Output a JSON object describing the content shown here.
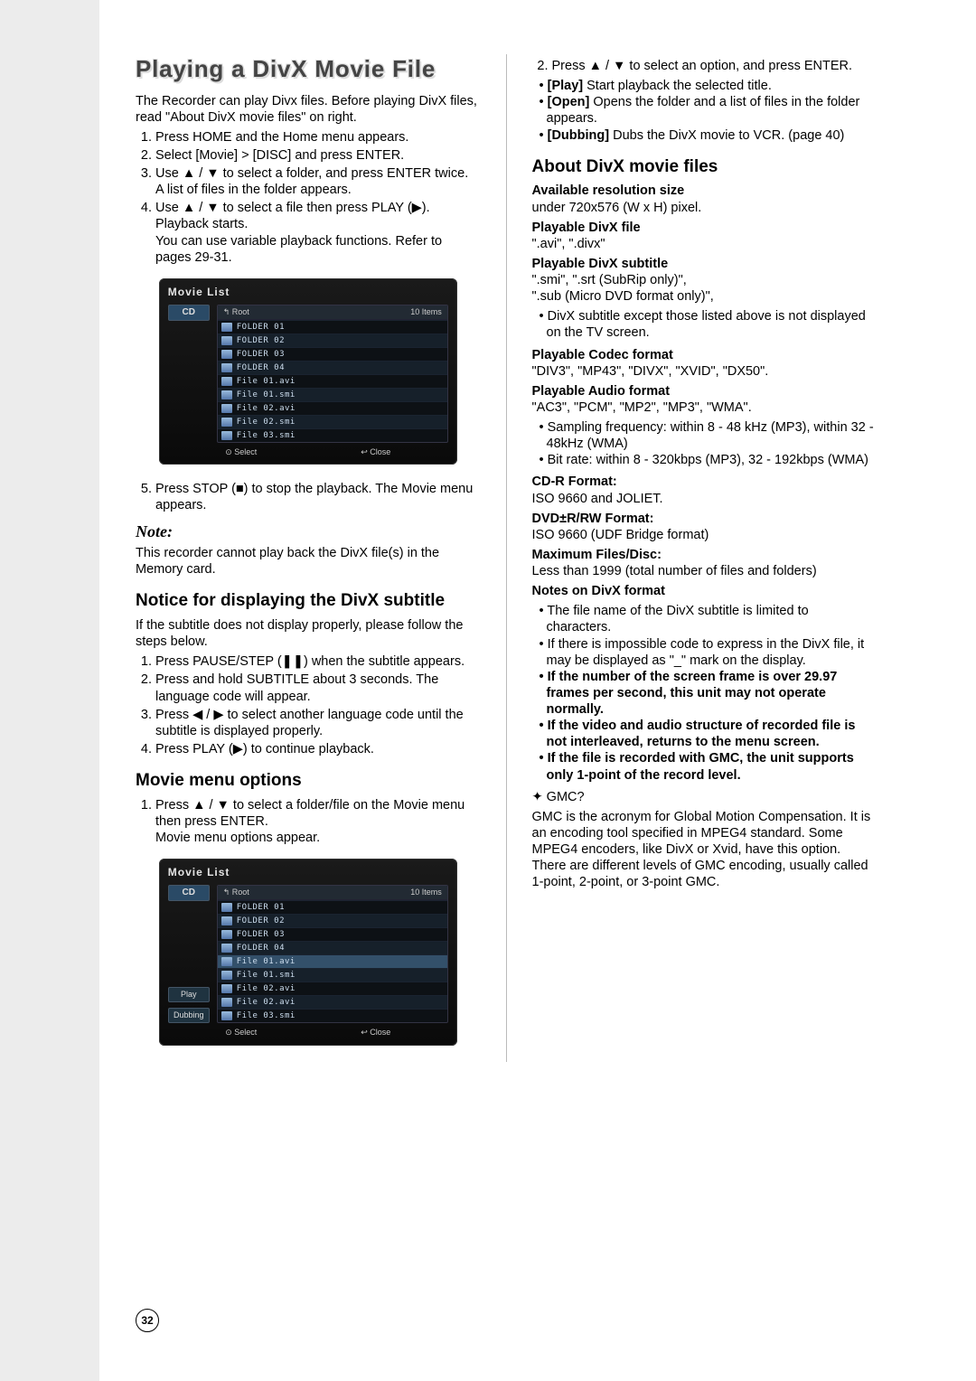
{
  "page_number": "32",
  "title": "Playing a DivX Movie File",
  "intro": "The Recorder can play Divx files. Before playing DivX files, read \"About DivX movie files\" on right.",
  "steps_main": [
    "Press HOME and the Home menu appears.",
    "Select [Movie] > [DISC] and press ENTER.",
    "Use ▲ / ▼ to select a folder, and press ENTER twice.\nA list of files in the folder appears.",
    "Use ▲ / ▼ to select a file then press PLAY (▶). Playback starts.\nYou can use variable playback functions. Refer to pages 29-31."
  ],
  "movie_list_panel_1": {
    "title": "Movie List",
    "disc": "CD",
    "head_left": "↰ Root",
    "head_right": "10 Items",
    "rows": [
      "FOLDER 01",
      "FOLDER 02",
      "FOLDER 03",
      "FOLDER 04",
      "File 01.avi",
      "File 01.smi",
      "File 02.avi",
      "File 02.smi",
      "File 03.smi"
    ],
    "foot_select": "⊙ Select",
    "foot_close": "↩ Close"
  },
  "step5": "Press STOP (■) to stop the playback. The Movie menu appears.",
  "note_label": "Note:",
  "note_text": "This recorder cannot play back the DivX file(s) in the Memory card.",
  "subtitle_heading": "Notice for displaying the DivX subtitle",
  "subtitle_intro": "If the subtitle does not display properly, please follow the steps below.",
  "subtitle_steps": [
    "Press PAUSE/STEP (❚❚) when the subtitle appears.",
    "Press and hold SUBTITLE about 3 seconds. The language code will appear.",
    "Press ◀ / ▶ to select another language code until the subtitle is displayed properly.",
    "Press PLAY (▶) to continue playback."
  ],
  "menu_heading": "Movie menu options",
  "menu_step1": "Press ▲ / ▼ to select a folder/file on the Movie menu then press ENTER.\nMovie menu options appear.",
  "movie_list_panel_2": {
    "title": "Movie List",
    "disc": "CD",
    "options": [
      "Play",
      "Dubbing"
    ],
    "head_left": "↰ Root",
    "head_right": "10 Items",
    "rows": [
      "FOLDER 01",
      "FOLDER 02",
      "FOLDER 03",
      "FOLDER 04",
      "File 01.avi",
      "File 01.smi",
      "File 02.avi",
      "File 02.avi",
      "File 03.smi"
    ],
    "foot_select": "⊙ Select",
    "foot_close": "↩ Close"
  },
  "step2_right": "Press ▲ / ▼ to select an option, and press ENTER.",
  "options_list": [
    {
      "b": "[Play]",
      "t": " Start playback the selected title."
    },
    {
      "b": "[Open]",
      "t": " Opens the folder and a list of files in the folder appears."
    },
    {
      "b": "[Dubbing]",
      "t": " Dubs the DivX movie to VCR. (page 40)"
    }
  ],
  "about_heading": "About DivX movie files",
  "about": {
    "res_h": "Available resolution size",
    "res_t": "under 720x576 (W x H) pixel.",
    "file_h": "Playable DivX file",
    "file_t": "\".avi\", \".divx\"",
    "sub_h": "Playable DivX subtitle",
    "sub_t1": "\".smi\", \".srt (SubRip only)\",",
    "sub_t2": "\".sub (Micro DVD format only)\",",
    "sub_t3": "DivX subtitle except those listed above is not displayed on the TV screen.",
    "codec_h": "Playable Codec format",
    "codec_t": "\"DIV3\", \"MP43\", \"DIVX\", \"XVID\", \"DX50\".",
    "audio_h": "Playable Audio format",
    "audio_t": "\"AC3\", \"PCM\", \"MP2\", \"MP3\", \"WMA\".",
    "audio_b1": "Sampling frequency: within 8 - 48 kHz (MP3), within 32 - 48kHz (WMA)",
    "audio_b2": "Bit rate: within 8 - 320kbps (MP3), 32 - 192kbps (WMA)",
    "cdr_h": "CD-R Format:",
    "cdr_t": "ISO 9660 and JOLIET.",
    "dvd_h": "DVD±R/RW Format:",
    "dvd_t": "ISO 9660 (UDF Bridge format)",
    "max_h": "Maximum Files/Disc:",
    "max_t": "Less than 1999 (total number of files and folders)",
    "notes_h": "Notes on DivX format",
    "note1": "The file name of the DivX subtitle is limited to characters.",
    "note2": "If there is impossible code to express in the DivX file, it may be displayed as \"_\" mark on the display.",
    "note3": "If the number of the screen frame is over 29.97 frames per second, this unit may not operate normally.",
    "note4": "If the video and audio structure of recorded file is not interleaved, returns to the menu screen.",
    "note5": "If the file is recorded with GMC, the unit supports only 1-point of the record level.",
    "gmc_q": "✦ GMC?",
    "gmc_a": "GMC is the acronym for Global Motion Compensation. It is an encoding tool specified in MPEG4 standard. Some MPEG4 encoders, like DivX or Xvid, have this option.\nThere are different levels of GMC encoding, usually called 1-point, 2-point, or 3-point GMC."
  }
}
